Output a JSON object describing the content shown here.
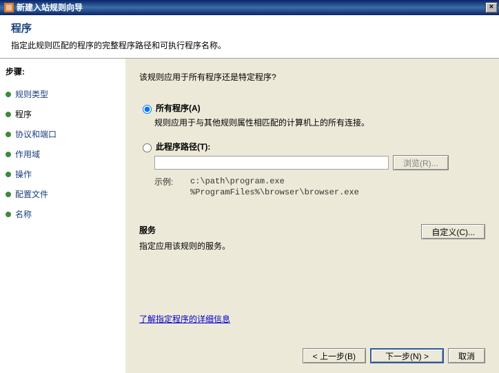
{
  "window": {
    "title": "新建入站规则向导"
  },
  "header": {
    "title": "程序",
    "subtitle": "指定此规则匹配的程序的完整程序路径和可执行程序名称。"
  },
  "sidebar": {
    "steps_label": "步骤:",
    "items": [
      {
        "label": "规则类型"
      },
      {
        "label": "程序"
      },
      {
        "label": "协议和端口"
      },
      {
        "label": "作用域"
      },
      {
        "label": "操作"
      },
      {
        "label": "配置文件"
      },
      {
        "label": "名称"
      }
    ]
  },
  "content": {
    "question": "该规则应用于所有程序还是特定程序?",
    "opt_all": {
      "label": "所有程序(A)",
      "desc": "规则应用于与其他规则属性相匹配的计算机上的所有连接。"
    },
    "opt_path": {
      "label": "此程序路径(T):",
      "input_value": "",
      "browse": "浏览(R)...",
      "example_label": "示例:",
      "example_text": "c:\\path\\program.exe\n%ProgramFiles%\\browser\\browser.exe"
    },
    "services": {
      "title": "服务",
      "desc": "指定应用该规则的服务。",
      "customize": "自定义(C)..."
    },
    "learn_link": "了解指定程序的详细信息"
  },
  "footer": {
    "back": "< 上一步(B)",
    "next": "下一步(N) >",
    "cancel": "取消"
  }
}
